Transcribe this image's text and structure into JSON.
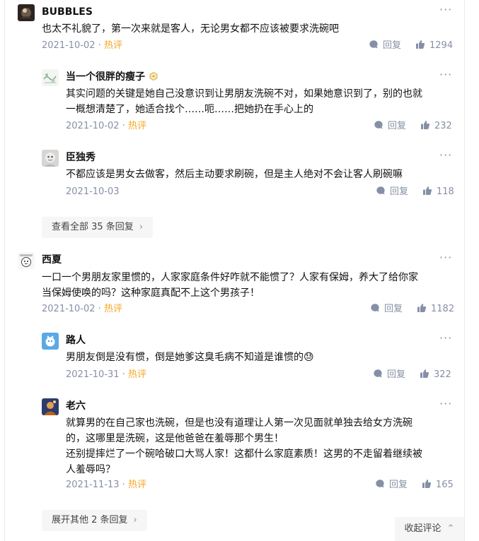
{
  "comments": [
    {
      "author": "BUBBLES",
      "text_lines": [
        "也太不礼貌了，第一次来就是客人，无论男女都不应该被要求洗碗吧"
      ],
      "date": "2021-10-02",
      "hot_label": "热评",
      "reply_label": "回复",
      "likes": "1294",
      "more": "···",
      "replies": [
        {
          "author": "当一个很胖的瘦子",
          "text_lines": [
            "其实问题的关键是她自己没意识到让男朋友洗碗不对，如果她意识到了，别的也就",
            "一概想清楚了，她适合找个……呃……把她扔在手心上的"
          ],
          "date": "2021-10-02",
          "hot_label": "热评",
          "reply_label": "回复",
          "likes": "232",
          "more": "···"
        },
        {
          "author": "臣独秀",
          "text_lines": [
            "不都应该是男女去做客，然后主动要求刷碗，但是主人绝对不会让客人刷碗嘛"
          ],
          "date": "2021-10-03",
          "reply_label": "回复",
          "likes": "118",
          "more": "···"
        }
      ],
      "view_all_label": "查看全部 35 条回复"
    },
    {
      "author": "西夏",
      "text_lines": [
        "一口一个男朋友家里惯的，人家家庭条件好咋就不能惯了？人家有保姆，养大了给你家",
        "当保姆使唤的吗？这种家庭真配不上这个男孩子！"
      ],
      "date": "2021-10-02",
      "hot_label": "热评",
      "reply_label": "回复",
      "likes": "1182",
      "more": "···",
      "replies": [
        {
          "author": "路人",
          "text_lines": [
            "男朋友倒是没有惯，倒是她爹这臭毛病不知道是谁惯的😓"
          ],
          "date": "2021-10-31",
          "hot_label": "热评",
          "reply_label": "回复",
          "likes": "322",
          "more": "···"
        },
        {
          "author": "老六",
          "text_lines": [
            "就算男的在自己家也洗碗，但是也没有道理让人第一次见面就单独去给女方洗碗",
            "的，这哪里是洗碗，这是他爸爸在羞辱那个男生！",
            "还别提摔烂了一个碗哈破口大骂人家！这都什么家庭素质！这男的不走留着继续被",
            "人羞辱吗？"
          ],
          "date": "2021-11-13",
          "hot_label": "热评",
          "reply_label": "回复",
          "likes": "165",
          "more": "···"
        }
      ],
      "view_all_label": "展开其他 2 条回复"
    }
  ],
  "chevron": "›",
  "collapse_label": "收起评论",
  "collapse_chevron": "⌃"
}
